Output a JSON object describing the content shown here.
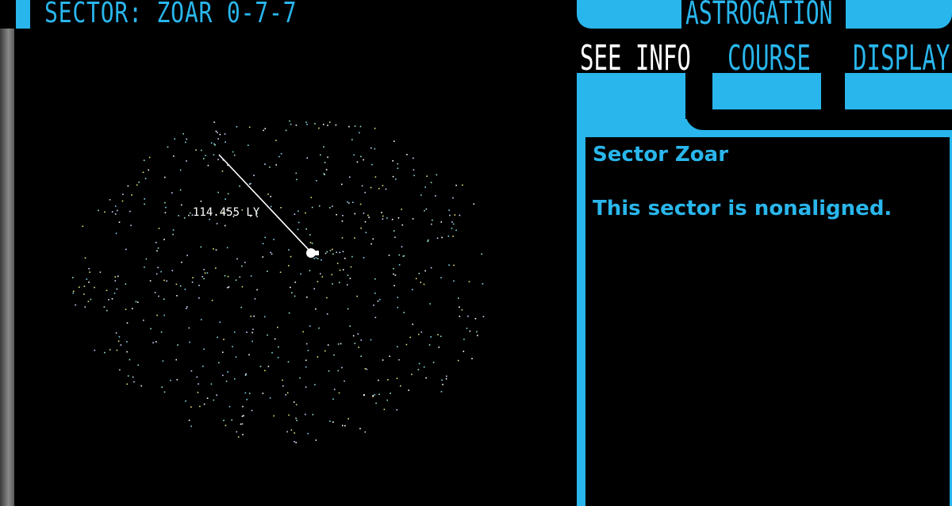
{
  "header": {
    "sector_title": "SECTOR: ZOAR 0-7-7"
  },
  "panel": {
    "title": "ASTROGATION",
    "tabs": [
      {
        "label": "SEE INFO",
        "active": true
      },
      {
        "label": "COURSE",
        "active": false
      },
      {
        "label": "DISPLAY",
        "active": false
      }
    ]
  },
  "info": {
    "heading": "Sector Zoar",
    "text": "This sector is nonaligned."
  },
  "starmap": {
    "distance_label": "114.455 LY",
    "star_colors": [
      "#7fd8e8",
      "#e8e07a",
      "#9be8c0",
      "#ffffff",
      "#c8d8ff"
    ]
  },
  "colors": {
    "accent": "#29b6ec",
    "frame": "#8a8a8a",
    "background": "#000000"
  }
}
